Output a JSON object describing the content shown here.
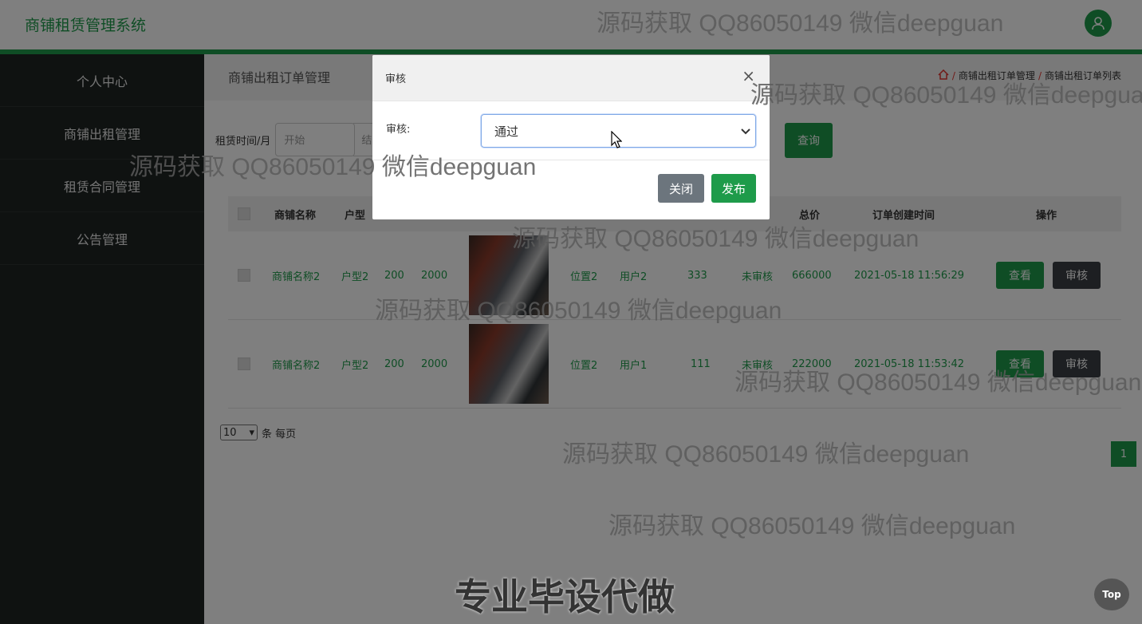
{
  "app": {
    "title": "商铺租赁管理系统"
  },
  "colors": {
    "brand": "#1e9b4a",
    "sidebar": "#1f2423",
    "dark_button": "#3a3f44"
  },
  "sidebar": {
    "items": [
      {
        "label": "个人中心"
      },
      {
        "label": "商铺出租管理"
      },
      {
        "label": "租赁合同管理"
      },
      {
        "label": "公告管理"
      }
    ]
  },
  "header": {
    "page_title": "商铺出租订单管理",
    "breadcrumb": {
      "home_icon": "home-icon",
      "level1": "商铺出租订单管理",
      "level2": "商铺出租订单列表"
    }
  },
  "search": {
    "label": "租赁时间/月",
    "start_placeholder": "开始",
    "end_placeholder": "结",
    "query_label": "查询"
  },
  "table": {
    "columns": {
      "name": "商铺名称",
      "type": "户型",
      "total": "总价",
      "created": "订单创建时间",
      "actions": "操作"
    },
    "rows": [
      {
        "name": "商铺名称2",
        "type": "户型2",
        "area": "200",
        "price": "2000",
        "location": "位置2",
        "user": "用户2",
        "phone": "333",
        "status": "未审核",
        "total": "666000",
        "created": "2021-05-18 11:56:29"
      },
      {
        "name": "商铺名称2",
        "type": "户型2",
        "area": "200",
        "price": "2000",
        "location": "位置2",
        "user": "用户1",
        "phone": "111",
        "status": "未审核",
        "total": "222000",
        "created": "2021-05-18 11:53:42"
      }
    ],
    "view_label": "查看",
    "audit_label": "审核"
  },
  "pagination": {
    "page_size": "10",
    "per_page_text": "条 每页",
    "current_page": "1"
  },
  "modal": {
    "title": "审核",
    "close_glyph": "×",
    "field_label": "审核:",
    "select_value": "通过",
    "close_label": "关闭",
    "publish_label": "发布"
  },
  "watermark": {
    "text": "源码获取 QQ86050149 微信deepguan"
  },
  "footer_ad": "专业毕设代做",
  "back_to_top": "Top"
}
